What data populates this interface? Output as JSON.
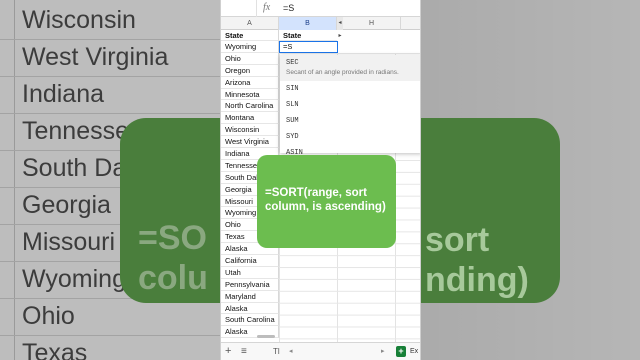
{
  "formula_bar": {
    "fx_label": "fx",
    "formula": "=S"
  },
  "columns": {
    "a": "A",
    "b": "B",
    "h": "H",
    "collapsed_marker": "◂ ▸"
  },
  "column_a": {
    "header": "State",
    "states": [
      "Wyoming",
      "Ohio",
      "Oregon",
      "Arizona",
      "Minnesota",
      "North Carolina",
      "Montana",
      "Wisconsin",
      "West Virginia",
      "Indiana",
      "Tennessee",
      "South Dakota",
      "Georgia",
      "Missouri",
      "Wyoming",
      "Ohio",
      "Texas",
      "Alaska",
      "California",
      "Utah",
      "Pennsylvania",
      "Maryland",
      "Alaska",
      "South Carolina",
      "Alaska"
    ]
  },
  "column_b": {
    "header": "State",
    "active_value": "=S"
  },
  "autocomplete": {
    "selected_name": "SEC",
    "selected_description": "Secant of an angle provided in radians.",
    "items": [
      "SIN",
      "SLN",
      "SUM",
      "SYD",
      "ASIN"
    ]
  },
  "overlay_card": {
    "text": "=SORT(range, sort column, is ascending)",
    "color": "#6cbd4f"
  },
  "background": {
    "names": [
      "Wisconsin",
      "West Virginia",
      "Indiana",
      "Tennesse",
      "South Da",
      "Georgia",
      "Missouri",
      "Wyoming",
      "Ohio",
      "Texas"
    ],
    "card_left_text": "=SO\ncolu",
    "card_right_text": "sort\nnding)"
  },
  "bottom_bar": {
    "add_icon": "+",
    "sheets_icon": "≡",
    "sheet_tab": "Tl",
    "scroll_left": "◂",
    "scroll_right": "▸",
    "explore_label": "Ex"
  }
}
